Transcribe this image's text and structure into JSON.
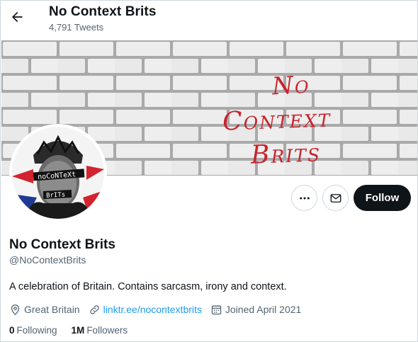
{
  "header": {
    "title": "No Context Brits",
    "tweet_count": "4,791 Tweets"
  },
  "banner": {
    "line1": "No",
    "line2": "Context",
    "line3": "Brits"
  },
  "actions": {
    "more_icon": "more-horizontal-icon",
    "message_icon": "envelope-icon",
    "follow_label": "Follow"
  },
  "profile": {
    "name": "No Context Brits",
    "handle": "@NoContextBrits",
    "bio": "A celebration of Britain. Contains sarcasm, irony and context.",
    "location": "Great Britain",
    "link": "linktr.ee/nocontextbrits",
    "joined": "Joined April 2021"
  },
  "stats": {
    "following_count": "0",
    "following_label": "Following",
    "followers_count": "1M",
    "followers_label": "Followers"
  },
  "colors": {
    "accent": "#1d9bf0",
    "follow_bg": "#0f1419",
    "banner_text": "#c8232c",
    "secondary_text": "#536471"
  }
}
